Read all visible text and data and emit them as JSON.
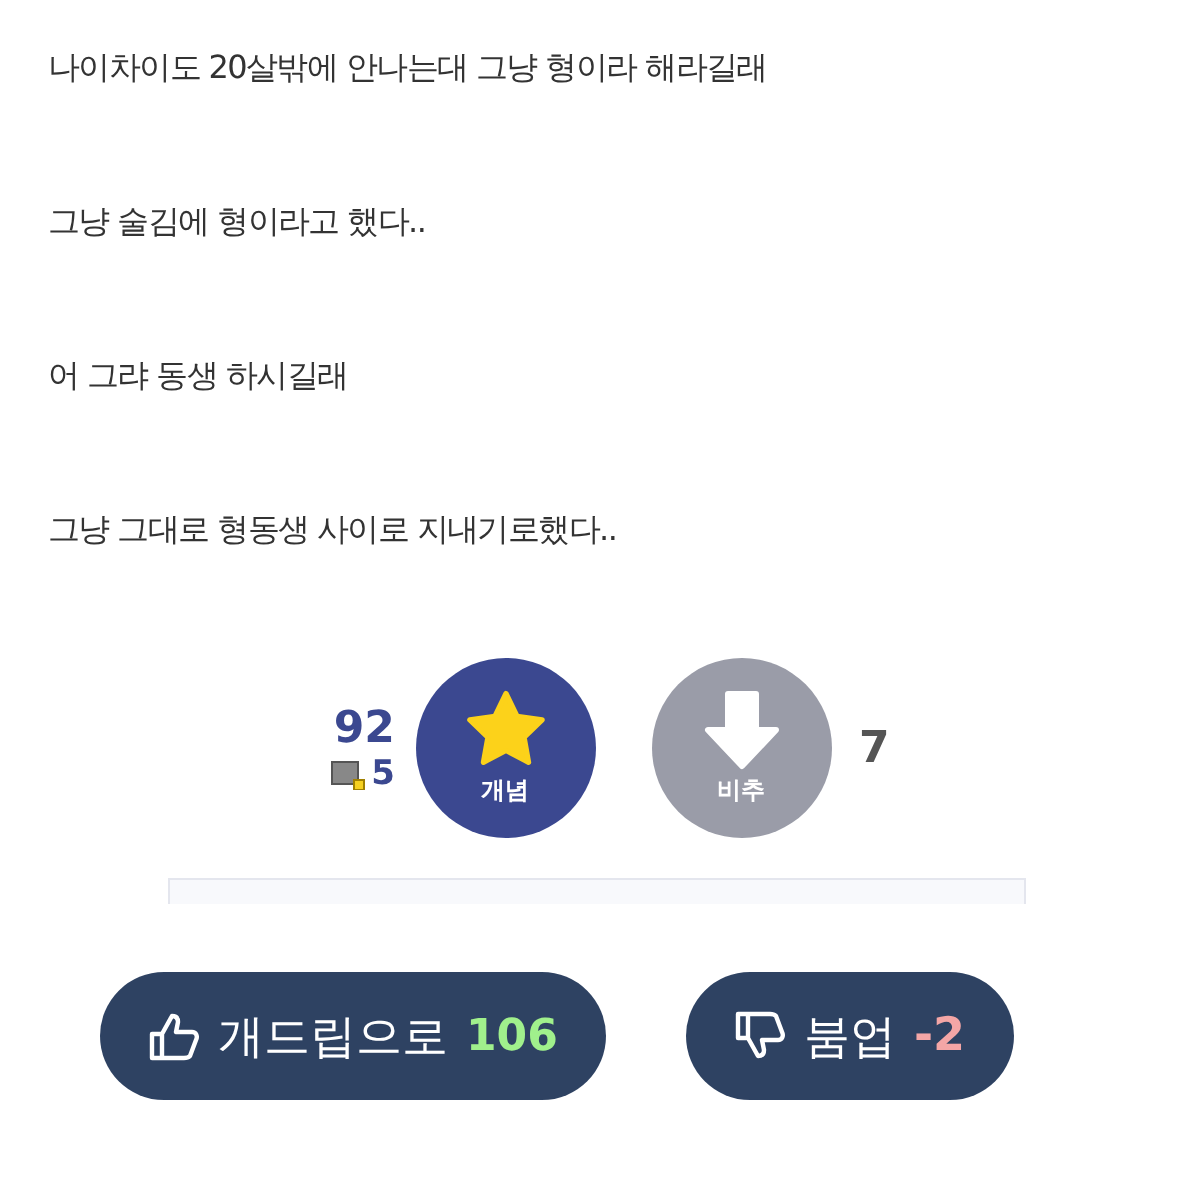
{
  "paragraphs": [
    "나이차이도 20살밖에 안나는대 그냥 형이라 해라길래",
    "그냥 술김에 형이라고 했다..",
    "어 그랴 동생 하시길래",
    "그냥 그대로 형동생 사이로 지내기로했다.."
  ],
  "vote": {
    "up_count": "92",
    "fixed_count": "5",
    "up_label": "개념",
    "down_label": "비추",
    "down_count": "7"
  },
  "actions": [
    {
      "kind": "up",
      "label": "개드립으로",
      "count": "106"
    },
    {
      "kind": "down",
      "label": "붐업",
      "count": "-2"
    }
  ]
}
